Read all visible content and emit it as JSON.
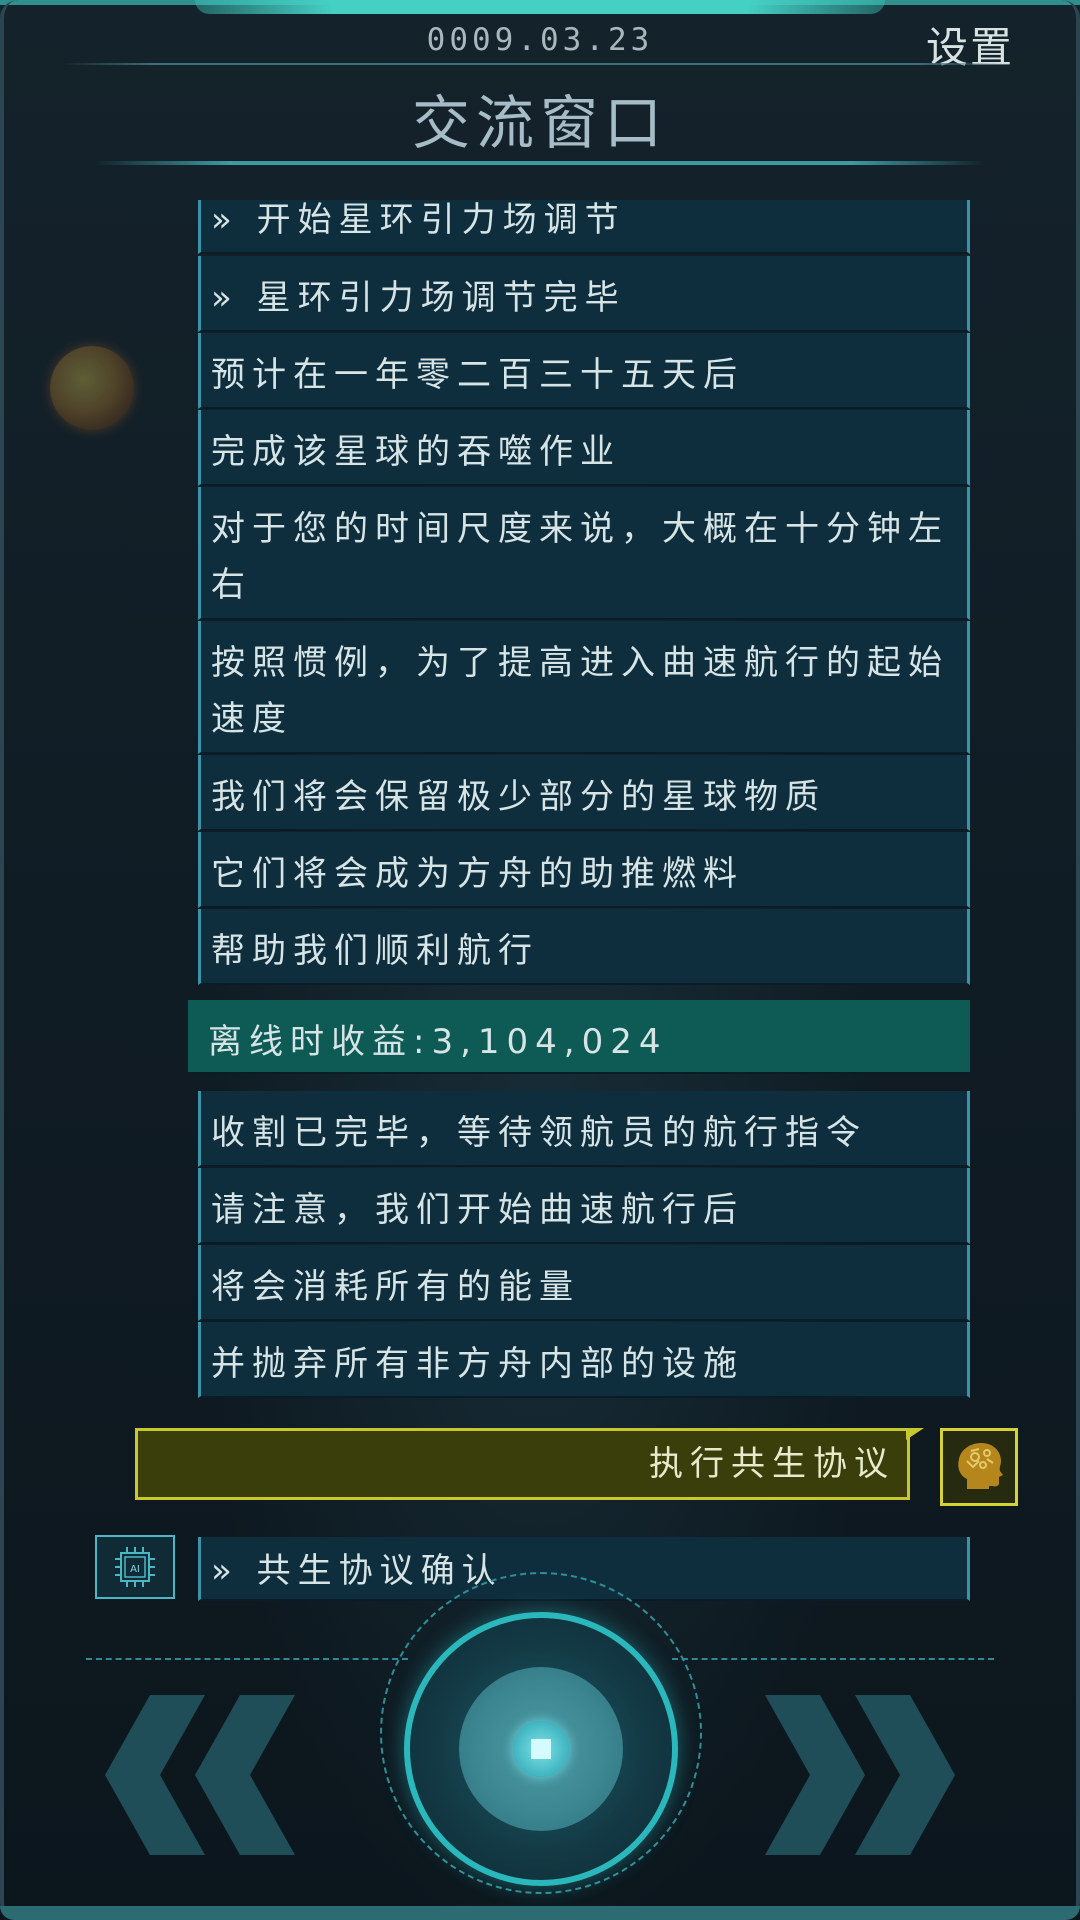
{
  "header": {
    "date": "0009.03.23",
    "settings_label": "设置",
    "title": "交流窗口"
  },
  "messages": [
    "» 开始星环引力场调节",
    "» 星环引力场调节完毕",
    "预计在一年零二百三十五天后",
    "完成该星球的吞噬作业",
    "对于您的时间尺度来说，大概在十分钟左右",
    "按照惯例，为了提高进入曲速航行的起始速度",
    "我们将会保留极少部分的星球物质",
    "它们将会成为方舟的助推燃料",
    "帮助我们顺利航行"
  ],
  "income_message": "离线时收益:3,104,024",
  "messages_after": [
    "收割已完毕，等待领航员的航行指令",
    "请注意，我们开始曲速航行后",
    "将会消耗所有的能量",
    "并抛弃所有非方舟内部的设施"
  ],
  "command": {
    "label": "执行共生协议",
    "avatar_icon": "brain-head-icon"
  },
  "ai_reply": {
    "icon": "ai-chip-icon",
    "text": "» 共生协议确认"
  },
  "controls": {
    "left_icon": "double-chevron-left-icon",
    "center_icon": "stop-square-icon",
    "right_icon": "double-chevron-right-icon"
  },
  "colors": {
    "accent": "#2bb8bd",
    "message_bg": "#0f2e3d",
    "income_bg": "#0e5a55",
    "command_border": "#c9c72e"
  }
}
